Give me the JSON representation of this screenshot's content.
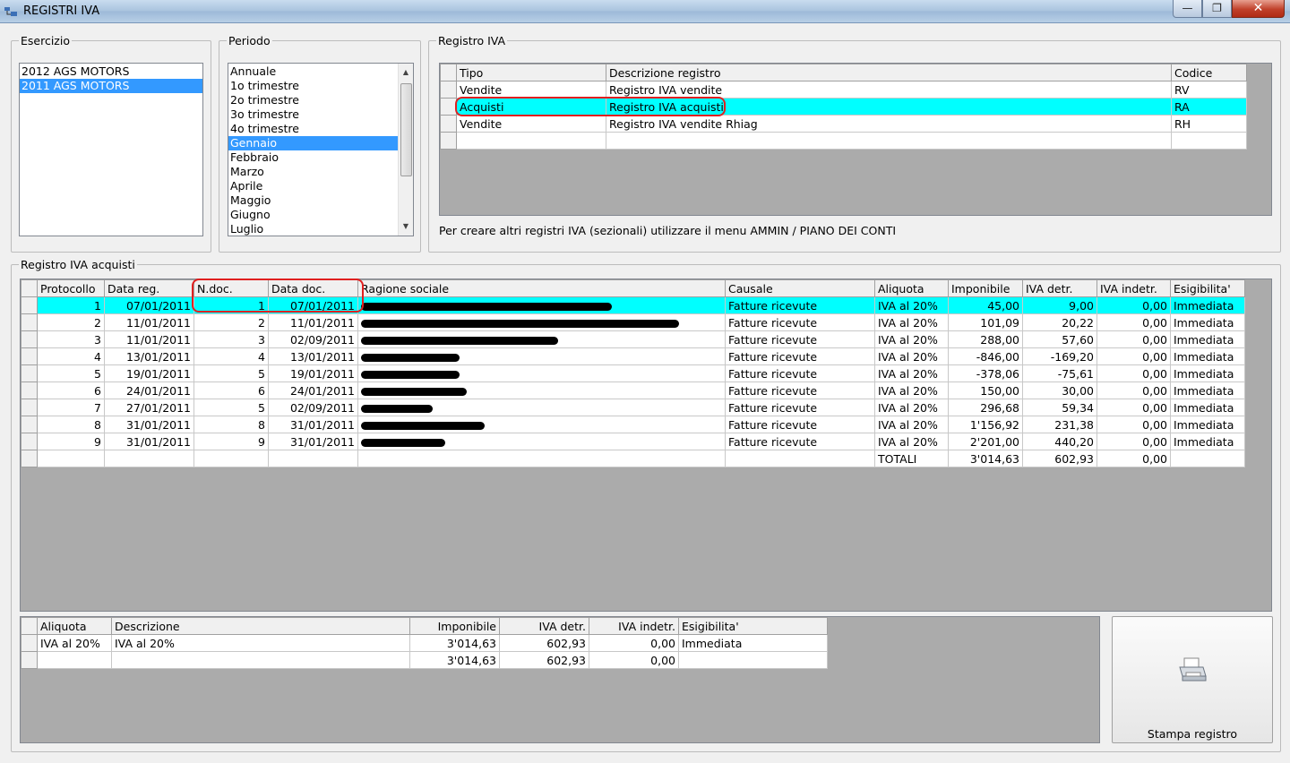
{
  "window": {
    "title": "REGISTRI IVA",
    "minimize": "—",
    "maximize": "❐",
    "close": "✕"
  },
  "esercizio": {
    "legend": "Esercizio",
    "items": [
      {
        "label": "2012 AGS MOTORS",
        "selected": false
      },
      {
        "label": "2011 AGS MOTORS",
        "selected": true
      }
    ]
  },
  "periodo": {
    "legend": "Periodo",
    "items": [
      {
        "label": "Annuale",
        "selected": false
      },
      {
        "label": "1o trimestre",
        "selected": false
      },
      {
        "label": "2o trimestre",
        "selected": false
      },
      {
        "label": "3o trimestre",
        "selected": false
      },
      {
        "label": "4o trimestre",
        "selected": false
      },
      {
        "label": "Gennaio",
        "selected": true
      },
      {
        "label": "Febbraio",
        "selected": false
      },
      {
        "label": "Marzo",
        "selected": false
      },
      {
        "label": "Aprile",
        "selected": false
      },
      {
        "label": "Maggio",
        "selected": false
      },
      {
        "label": "Giugno",
        "selected": false
      },
      {
        "label": "Luglio",
        "selected": false
      }
    ]
  },
  "registro": {
    "legend": "Registro IVA",
    "headers": [
      "Tipo",
      "Descrizione registro",
      "Codice"
    ],
    "rows": [
      [
        "Vendite",
        "Registro IVA vendite",
        "RV"
      ],
      [
        "Acquisti",
        "Registro IVA acquisti",
        "RA"
      ],
      [
        "Vendite",
        "Registro IVA vendite Rhiag",
        "RH"
      ],
      [
        "",
        "",
        ""
      ]
    ],
    "selected_row": 1,
    "hint": "Per creare altri registri IVA (sezionali) utilizzare il menu AMMIN / PIANO DEI CONTI"
  },
  "acquisti": {
    "legend": "Registro IVA acquisti",
    "headers": [
      "Protocollo",
      "Data reg.",
      "N.doc.",
      "Data doc.",
      "Ragione sociale",
      "Causale",
      "Aliquota",
      "Imponibile",
      "IVA detr.",
      "IVA indetr.",
      "Esigibilita'"
    ],
    "rows": [
      [
        "1",
        "07/01/2011",
        "1",
        "07/01/2011",
        "",
        "Fatture ricevute",
        "IVA al 20%",
        "45,00",
        "9,00",
        "0,00",
        "Immediata"
      ],
      [
        "2",
        "11/01/2011",
        "2",
        "11/01/2011",
        "",
        "Fatture ricevute",
        "IVA al 20%",
        "101,09",
        "20,22",
        "0,00",
        "Immediata"
      ],
      [
        "3",
        "11/01/2011",
        "3",
        "02/09/2011",
        "",
        "Fatture ricevute",
        "IVA al 20%",
        "288,00",
        "57,60",
        "0,00",
        "Immediata"
      ],
      [
        "4",
        "13/01/2011",
        "4",
        "13/01/2011",
        "",
        "Fatture ricevute",
        "IVA al 20%",
        "-846,00",
        "-169,20",
        "0,00",
        "Immediata"
      ],
      [
        "5",
        "19/01/2011",
        "5",
        "19/01/2011",
        "",
        "Fatture ricevute",
        "IVA al 20%",
        "-378,06",
        "-75,61",
        "0,00",
        "Immediata"
      ],
      [
        "6",
        "24/01/2011",
        "6",
        "24/01/2011",
        "",
        "Fatture ricevute",
        "IVA al 20%",
        "150,00",
        "30,00",
        "0,00",
        "Immediata"
      ],
      [
        "7",
        "27/01/2011",
        "5",
        "02/09/2011",
        "",
        "Fatture ricevute",
        "IVA al 20%",
        "296,68",
        "59,34",
        "0,00",
        "Immediata"
      ],
      [
        "8",
        "31/01/2011",
        "8",
        "31/01/2011",
        "",
        "Fatture ricevute",
        "IVA al 20%",
        "1'156,92",
        "231,38",
        "0,00",
        "Immediata"
      ],
      [
        "9",
        "31/01/2011",
        "9",
        "31/01/2011",
        "",
        "Fatture ricevute",
        "IVA al 20%",
        "2'201,00",
        "440,20",
        "0,00",
        "Immediata"
      ]
    ],
    "totals": {
      "label": "TOTALI",
      "imponibile": "3'014,63",
      "iva_detr": "602,93",
      "iva_indetr": "0,00"
    }
  },
  "riepilogo": {
    "headers": [
      "Aliquota",
      "Descrizione",
      "Imponibile",
      "IVA detr.",
      "IVA indetr.",
      "Esigibilita'"
    ],
    "rows": [
      [
        "IVA al 20%",
        "IVA al 20%",
        "3'014,63",
        "602,93",
        "0,00",
        "Immediata"
      ],
      [
        "",
        "",
        "3'014,63",
        "602,93",
        "0,00",
        ""
      ]
    ]
  },
  "print_button": {
    "label": "Stampa registro"
  },
  "colors": {
    "selection_blue": "#3399ff",
    "highlight_cyan": "#00ffff",
    "annotation_red": "#e02020",
    "grid_background": "#ababab"
  }
}
